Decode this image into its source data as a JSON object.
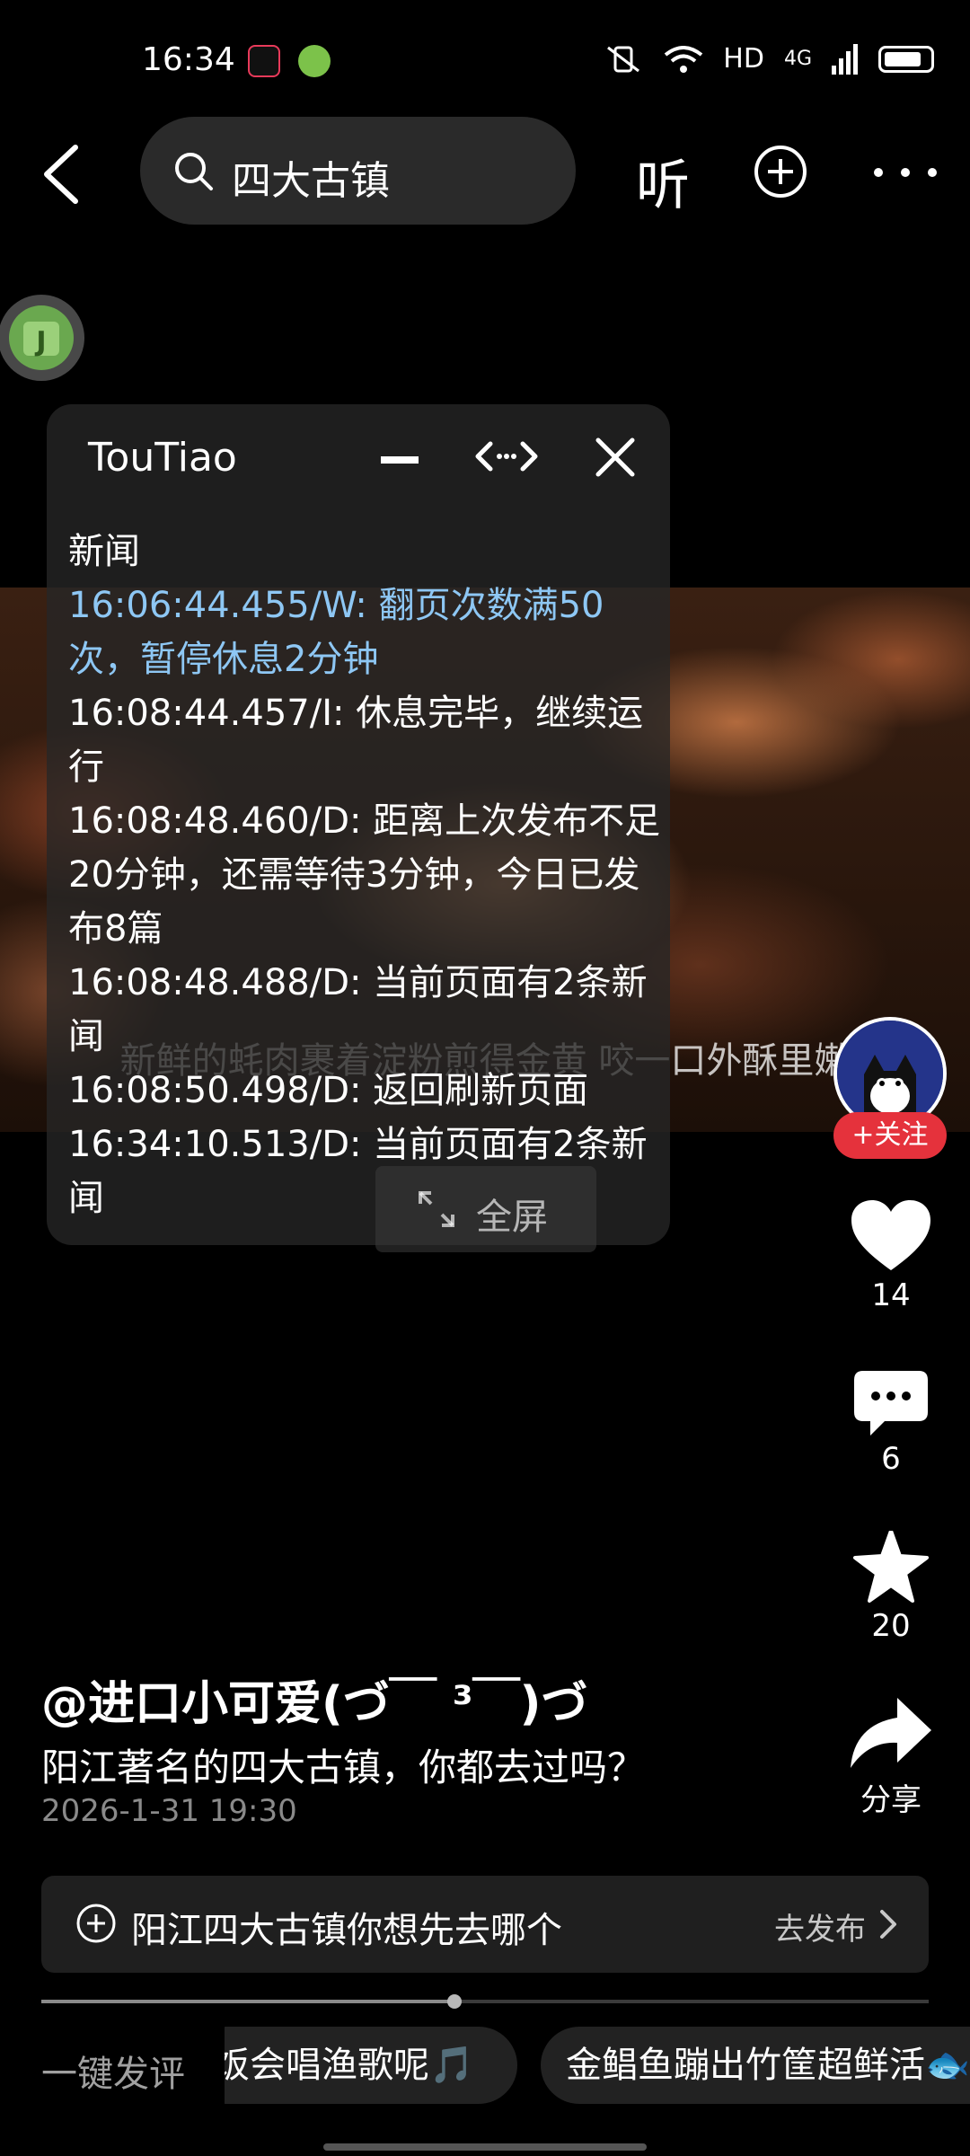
{
  "status_bar": {
    "time": "16:34",
    "network": "HD",
    "signal_type": "4G"
  },
  "header": {
    "search_text": "四大古镇",
    "listen_label": "听"
  },
  "log_panel": {
    "title": "TouTiao",
    "lines": [
      {
        "text": "新闻",
        "level": "normal"
      },
      {
        "text": "16:06:44.455/W: 翻页次数满50次，暂停休息2分钟",
        "level": "warn"
      },
      {
        "text": "16:08:44.457/I: 休息完毕，继续运行",
        "level": "normal"
      },
      {
        "text": "16:08:48.460/D: 距离上次发布不足20分钟，还需等待3分钟，今日已发布8篇",
        "level": "normal"
      },
      {
        "text": "16:08:48.488/D: 当前页面有2条新闻",
        "level": "normal"
      },
      {
        "text": "16:08:50.498/D: 返回刷新页面",
        "level": "normal"
      },
      {
        "text": "16:34:10.513/D: 当前页面有2条新闻",
        "level": "normal"
      }
    ],
    "fullscreen_label": "全屏"
  },
  "video": {
    "caption": "新鲜的蚝肉裹着淀粉煎得金黄 咬一口外酥里嫩"
  },
  "actions": {
    "follow_label": "+关注",
    "like_count": "14",
    "comment_count": "6",
    "favorite_count": "20",
    "share_label": "分享"
  },
  "post": {
    "author": "@进口小可爱(づ￣ ³￣)づ",
    "title": "阳江著名的四大古镇，你都去过吗？",
    "time": "2026-1-31 19:30"
  },
  "topic": {
    "text": "阳江四大古镇你想先去哪个",
    "action": "去发布"
  },
  "playback": {
    "progress": 0.466
  },
  "quick_comment": {
    "label": "一键发评",
    "chips": [
      "饭会唱渔歌呢🎵",
      "金鲳鱼蹦出竹筐超鲜活🐟"
    ]
  }
}
